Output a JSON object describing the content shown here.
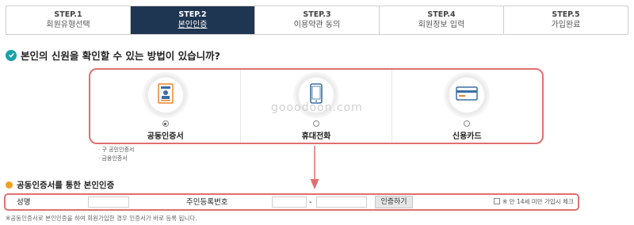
{
  "steps": [
    {
      "num": "STEP.1",
      "label": "회원유형선택"
    },
    {
      "num": "STEP.2",
      "label": "본인인증"
    },
    {
      "num": "STEP.3",
      "label": "이용약관 동의"
    },
    {
      "num": "STEP.4",
      "label": "회원정보 입력"
    },
    {
      "num": "STEP.5",
      "label": "가입완료"
    }
  ],
  "active_step": 2,
  "question": "본인의 신원을 확인할 수 있는 방법이 있습니까?",
  "methods": [
    {
      "label": "공동인증서",
      "icon": "certificate-icon",
      "selected": true
    },
    {
      "label": "휴대전화",
      "icon": "mobile-phone-icon",
      "selected": false
    },
    {
      "label": "신용카드",
      "icon": "credit-card-icon",
      "selected": false
    }
  ],
  "sub_links": [
    "구 공인인증서",
    "금융인증서"
  ],
  "watermark": "gooodoon.com",
  "section_title": "공동인증서를 통한 본인인증",
  "form": {
    "name_label": "성명",
    "rrn_label": "주민등록번호",
    "dash": "-",
    "verify_button": "인증하기",
    "under14_label": "※ 만 14세 미만 가입시 체크"
  },
  "note": "※공동인증서로 본인인증을 하여 회원가입한 경우 인증서가 바로 등록 됩니다.",
  "colors": {
    "active_step_bg": "#1f3652",
    "highlight_border": "#e07070",
    "check_icon": "#1aa2a8",
    "section_dot": "#f0a020"
  }
}
